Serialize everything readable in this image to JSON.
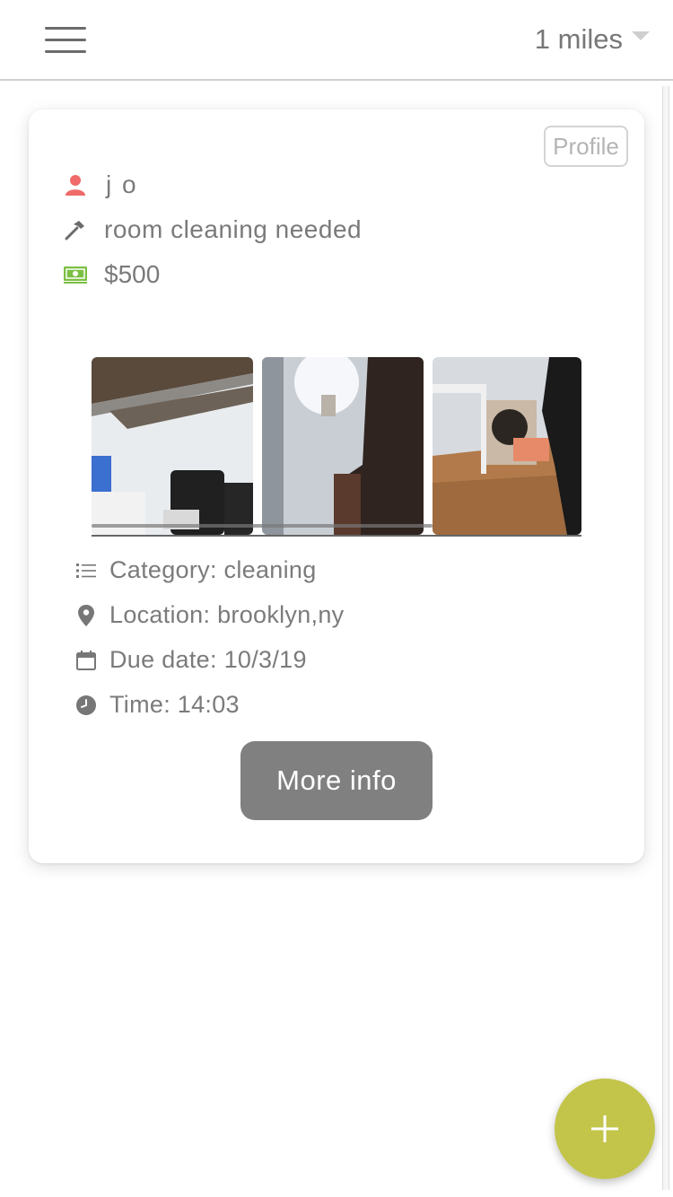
{
  "header": {
    "distance_label": "1 miles",
    "menu_icon": "hamburger-menu-icon",
    "dropdown_icon": "caret-down-icon"
  },
  "card": {
    "profile_label": "Profile",
    "user": {
      "name": "j o",
      "icon": "person-icon",
      "icon_color": "#f06a6a"
    },
    "task": {
      "title": "room cleaning needed",
      "icon": "hammer-icon"
    },
    "price": {
      "amount": "$500",
      "icon": "money-icon",
      "icon_color": "#7cc043"
    },
    "details": {
      "category": "Category: cleaning",
      "location": "Location: brooklyn,ny",
      "due_date": "Due date: 10/3/19",
      "time": "Time: 14:03"
    },
    "more_info_label": "More info"
  },
  "fab": {
    "label": "+",
    "color": "#c3c54a"
  }
}
